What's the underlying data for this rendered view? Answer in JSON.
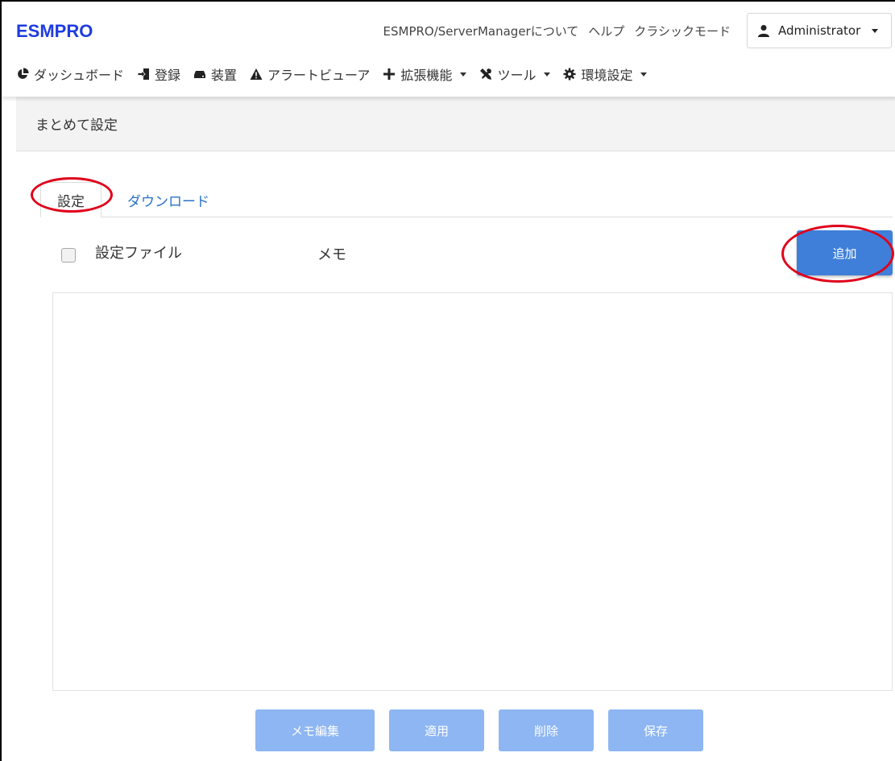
{
  "header": {
    "logo": "ESMPRO",
    "links": [
      "ESMPRO/ServerManagerについて",
      "ヘルプ",
      "クラシックモード"
    ],
    "user": "Administrator"
  },
  "nav": {
    "items": [
      {
        "label": "ダッシュボード",
        "icon": "pie-chart-icon",
        "dropdown": false
      },
      {
        "label": "登録",
        "icon": "sign-in-icon",
        "dropdown": false
      },
      {
        "label": "装置",
        "icon": "hdd-icon",
        "dropdown": false
      },
      {
        "label": "アラートビューア",
        "icon": "warning-icon",
        "dropdown": false
      },
      {
        "label": "拡張機能",
        "icon": "plus-icon",
        "dropdown": true
      },
      {
        "label": "ツール",
        "icon": "tools-icon",
        "dropdown": true
      },
      {
        "label": "環境設定",
        "icon": "gear-icon",
        "dropdown": true
      }
    ]
  },
  "page": {
    "title": "まとめて設定"
  },
  "tabs": {
    "settings": "設定",
    "download": "ダウンロード"
  },
  "table": {
    "col_file": "設定ファイル",
    "col_memo": "メモ",
    "add_label": "追加"
  },
  "footer": {
    "memo_edit": "メモ編集",
    "apply": "適用",
    "delete": "削除",
    "save": "保存"
  },
  "colors": {
    "logo": "#1f3ce0",
    "primary": "#3f7fd9",
    "disabled": "#8db6f2",
    "highlight_ring": "#e0001a",
    "link": "#2a72c9"
  }
}
